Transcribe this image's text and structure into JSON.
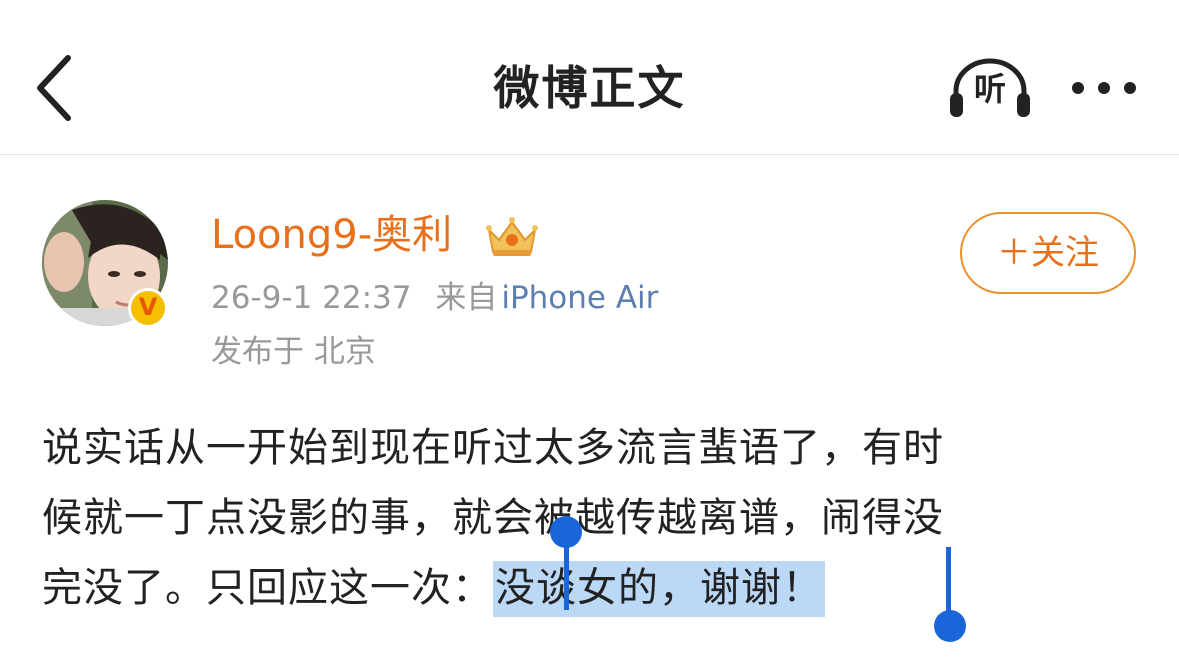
{
  "nav": {
    "title": "微博正文",
    "listen_label": "听",
    "back_icon": "chevron-left-icon",
    "more_icon": "more-dots-icon"
  },
  "author": {
    "name": "Loong9-奥利",
    "verified_badge": "V",
    "crown_icon": "crown-icon",
    "timestamp": "26-9-1 22:37",
    "source_prefix": "来自",
    "source_device": "iPhone Air",
    "location": "发布于 北京",
    "follow_label": "＋关注"
  },
  "post": {
    "line1": "说实话从一开始到现在听过太多流言蜚语了，有时",
    "line2": "候就一丁点没影的事，就会被越传越离谱，闹得没",
    "line3_prefix": "完没了。只回应这一次：",
    "line3_selected": "没谈女的，谢谢！"
  },
  "colors": {
    "username": "#e8701a",
    "follow_border": "#e8902f",
    "device_link": "#5b7fb0",
    "selection_bg": "#bcd8f7",
    "selection_handle": "#1a66d9",
    "verified_badge": "#f6c000"
  }
}
